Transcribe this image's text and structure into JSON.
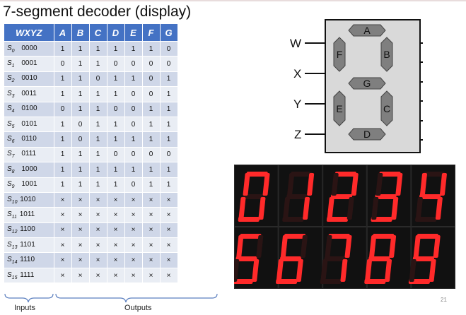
{
  "slide": {
    "title": "7-segment decoder (display)",
    "page_number": "21"
  },
  "table": {
    "headers": [
      "WXYZ",
      "A",
      "B",
      "C",
      "D",
      "E",
      "F",
      "G"
    ],
    "rows": [
      {
        "state": "S",
        "sub": "0",
        "code": "0000",
        "vals": [
          "1",
          "1",
          "1",
          "1",
          "1",
          "1",
          "0"
        ]
      },
      {
        "state": "S",
        "sub": "1",
        "code": "0001",
        "vals": [
          "0",
          "1",
          "1",
          "0",
          "0",
          "0",
          "0"
        ]
      },
      {
        "state": "S",
        "sub": "2",
        "code": "0010",
        "vals": [
          "1",
          "1",
          "0",
          "1",
          "1",
          "0",
          "1"
        ]
      },
      {
        "state": "S",
        "sub": "3",
        "code": "0011",
        "vals": [
          "1",
          "1",
          "1",
          "1",
          "0",
          "0",
          "1"
        ]
      },
      {
        "state": "S",
        "sub": "4",
        "code": "0100",
        "vals": [
          "0",
          "1",
          "1",
          "0",
          "0",
          "1",
          "1"
        ]
      },
      {
        "state": "S",
        "sub": "5",
        "code": "0101",
        "vals": [
          "1",
          "0",
          "1",
          "1",
          "0",
          "1",
          "1"
        ]
      },
      {
        "state": "S",
        "sub": "6",
        "code": "0110",
        "vals": [
          "1",
          "0",
          "1",
          "1",
          "1",
          "1",
          "1"
        ]
      },
      {
        "state": "S",
        "sub": "7",
        "code": "0111",
        "vals": [
          "1",
          "1",
          "1",
          "0",
          "0",
          "0",
          "0"
        ]
      },
      {
        "state": "S",
        "sub": "8",
        "code": "1000",
        "vals": [
          "1",
          "1",
          "1",
          "1",
          "1",
          "1",
          "1"
        ]
      },
      {
        "state": "S",
        "sub": "9",
        "code": "1001",
        "vals": [
          "1",
          "1",
          "1",
          "1",
          "0",
          "1",
          "1"
        ]
      },
      {
        "state": "S",
        "sub": "10",
        "code": "1010",
        "vals": [
          "×",
          "×",
          "×",
          "×",
          "×",
          "×",
          "×"
        ]
      },
      {
        "state": "S",
        "sub": "11",
        "code": "1011",
        "vals": [
          "×",
          "×",
          "×",
          "×",
          "×",
          "×",
          "×"
        ]
      },
      {
        "state": "S",
        "sub": "12",
        "code": "1100",
        "vals": [
          "×",
          "×",
          "×",
          "×",
          "×",
          "×",
          "×"
        ]
      },
      {
        "state": "S",
        "sub": "13",
        "code": "1101",
        "vals": [
          "×",
          "×",
          "×",
          "×",
          "×",
          "×",
          "×"
        ]
      },
      {
        "state": "S",
        "sub": "14",
        "code": "1110",
        "vals": [
          "×",
          "×",
          "×",
          "×",
          "×",
          "×",
          "×"
        ]
      },
      {
        "state": "S",
        "sub": "15",
        "code": "1111",
        "vals": [
          "×",
          "×",
          "×",
          "×",
          "×",
          "×",
          "×"
        ]
      }
    ]
  },
  "braces": {
    "inputs_label": "Inputs",
    "outputs_label": "Outputs"
  },
  "diagram": {
    "inputs": [
      "W",
      "X",
      "Y",
      "Z"
    ],
    "segments": [
      "A",
      "B",
      "C",
      "D",
      "E",
      "F",
      "G"
    ]
  },
  "photo": {
    "digits": [
      [
        "0",
        "1",
        "2",
        "3",
        "4"
      ],
      [
        "5",
        "6",
        "7",
        "8",
        "9"
      ]
    ]
  },
  "colors": {
    "header_bg": "#4472c4",
    "row_odd": "#cfd7e8",
    "row_even": "#e9edf4",
    "display_body": "#d9d9d9",
    "segment_fill": "#7f7f7f",
    "led_red": "#ff2a2a"
  }
}
